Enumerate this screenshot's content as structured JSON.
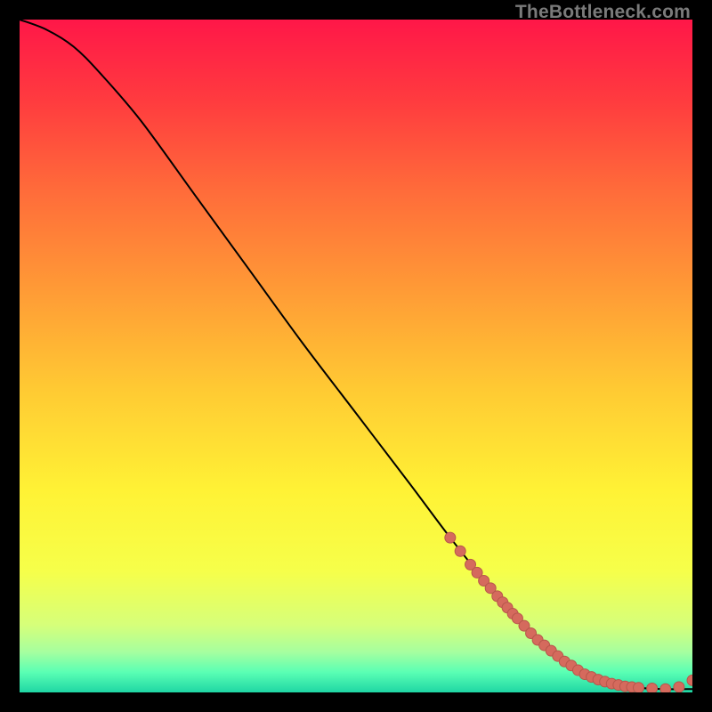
{
  "watermark": "TheBottleneck.com",
  "colors": {
    "line": "#000000",
    "marker_fill": "#d56a5d",
    "marker_stroke": "#b7564b",
    "background_black": "#000000",
    "watermark": "#7a7a7a"
  },
  "gradient_stops": [
    {
      "offset": 0.0,
      "color": "#ff1748"
    },
    {
      "offset": 0.12,
      "color": "#ff3b3f"
    },
    {
      "offset": 0.25,
      "color": "#ff6a3a"
    },
    {
      "offset": 0.4,
      "color": "#ff9a36"
    },
    {
      "offset": 0.55,
      "color": "#ffca33"
    },
    {
      "offset": 0.7,
      "color": "#fff235"
    },
    {
      "offset": 0.82,
      "color": "#f6ff4a"
    },
    {
      "offset": 0.9,
      "color": "#d6ff7a"
    },
    {
      "offset": 0.94,
      "color": "#a6ff9f"
    },
    {
      "offset": 0.97,
      "color": "#5affb4"
    },
    {
      "offset": 1.0,
      "color": "#1fd6a4"
    }
  ],
  "chart_data": {
    "type": "line",
    "title": "",
    "xlabel": "",
    "ylabel": "",
    "xlim": [
      0,
      100
    ],
    "ylim": [
      0,
      100
    ],
    "series": [
      {
        "name": "curve",
        "x": [
          0,
          4,
          8,
          12,
          18,
          26,
          34,
          42,
          50,
          58,
          64,
          70,
          74,
          78,
          82,
          85,
          88,
          92,
          96,
          100
        ],
        "y": [
          100,
          98.5,
          96,
          92,
          85,
          74,
          63,
          52,
          41.5,
          31,
          23,
          15.5,
          11,
          7,
          4,
          2.3,
          1.3,
          0.7,
          0.5,
          0.5
        ]
      }
    ],
    "markers": [
      {
        "x": 64.0,
        "y": 23.0
      },
      {
        "x": 65.5,
        "y": 21.0
      },
      {
        "x": 67.0,
        "y": 19.0
      },
      {
        "x": 68.0,
        "y": 17.8
      },
      {
        "x": 69.0,
        "y": 16.6
      },
      {
        "x": 70.0,
        "y": 15.5
      },
      {
        "x": 71.0,
        "y": 14.3
      },
      {
        "x": 71.8,
        "y": 13.4
      },
      {
        "x": 72.5,
        "y": 12.6
      },
      {
        "x": 73.3,
        "y": 11.7
      },
      {
        "x": 74.0,
        "y": 11.0
      },
      {
        "x": 75.0,
        "y": 9.9
      },
      {
        "x": 76.0,
        "y": 8.8
      },
      {
        "x": 77.0,
        "y": 7.8
      },
      {
        "x": 78.0,
        "y": 7.0
      },
      {
        "x": 79.0,
        "y": 6.2
      },
      {
        "x": 80.0,
        "y": 5.4
      },
      {
        "x": 81.0,
        "y": 4.6
      },
      {
        "x": 82.0,
        "y": 4.0
      },
      {
        "x": 83.0,
        "y": 3.3
      },
      {
        "x": 84.0,
        "y": 2.7
      },
      {
        "x": 85.0,
        "y": 2.3
      },
      {
        "x": 86.0,
        "y": 1.9
      },
      {
        "x": 87.0,
        "y": 1.6
      },
      {
        "x": 88.0,
        "y": 1.3
      },
      {
        "x": 89.0,
        "y": 1.1
      },
      {
        "x": 90.0,
        "y": 0.9
      },
      {
        "x": 91.0,
        "y": 0.8
      },
      {
        "x": 92.0,
        "y": 0.7
      },
      {
        "x": 94.0,
        "y": 0.6
      },
      {
        "x": 96.0,
        "y": 0.5
      },
      {
        "x": 98.0,
        "y": 0.8
      },
      {
        "x": 100.0,
        "y": 1.8
      }
    ]
  }
}
